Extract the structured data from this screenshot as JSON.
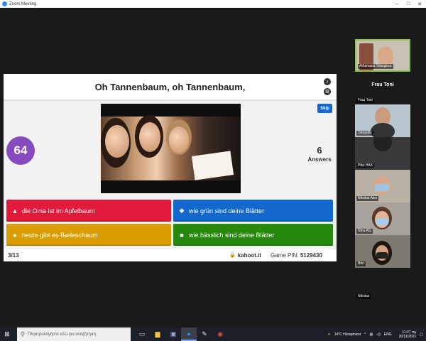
{
  "window": {
    "title": "Zoom Meeting"
  },
  "kahoot": {
    "question": "Oh Tannenbaum, oh Tannenbaum,",
    "timer": "64",
    "skip_label": "Skip",
    "answers_count": "6",
    "answers_label": "Answers",
    "options": [
      {
        "shape": "▲",
        "text": "die Oma ist im Apfelbaum",
        "color": "#e21b3c"
      },
      {
        "shape": "◆",
        "text": "wie grün sind deine Blätter",
        "color": "#1368ce"
      },
      {
        "shape": "●",
        "text": "heute gibt es Badeschaum",
        "color": "#d89e00"
      },
      {
        "shape": "■",
        "text": "wie hässlich sind deine Blätter",
        "color": "#26890c"
      }
    ],
    "progress": "3/13",
    "brand": "kahoot.it",
    "pin_label": "Game PIN:",
    "pin_value": "5129430"
  },
  "participants": [
    {
      "name": "Athanasia Tsitsigkou",
      "active": true
    },
    {
      "name": "Frau Toni",
      "big_name": "Frau Toni"
    },
    {
      "name": "Jatopolis"
    },
    {
      "name": "Pilio HAX"
    },
    {
      "name": "Nikolas Alex"
    },
    {
      "name": "Nina Ata"
    },
    {
      "name": "Brin"
    },
    {
      "name": "Nikolas"
    }
  ],
  "taskbar": {
    "search_placeholder": "Πληκτρολογήστε εδώ για αναζήτηση",
    "weather": "14°C Ηλιοφάνεια",
    "lang": "ENG",
    "time": "11:27 πμ",
    "date": "30/11/2021"
  },
  "colors": {
    "kahoot_purple": "#864cbf",
    "zoom_blue": "#2d8cff"
  }
}
